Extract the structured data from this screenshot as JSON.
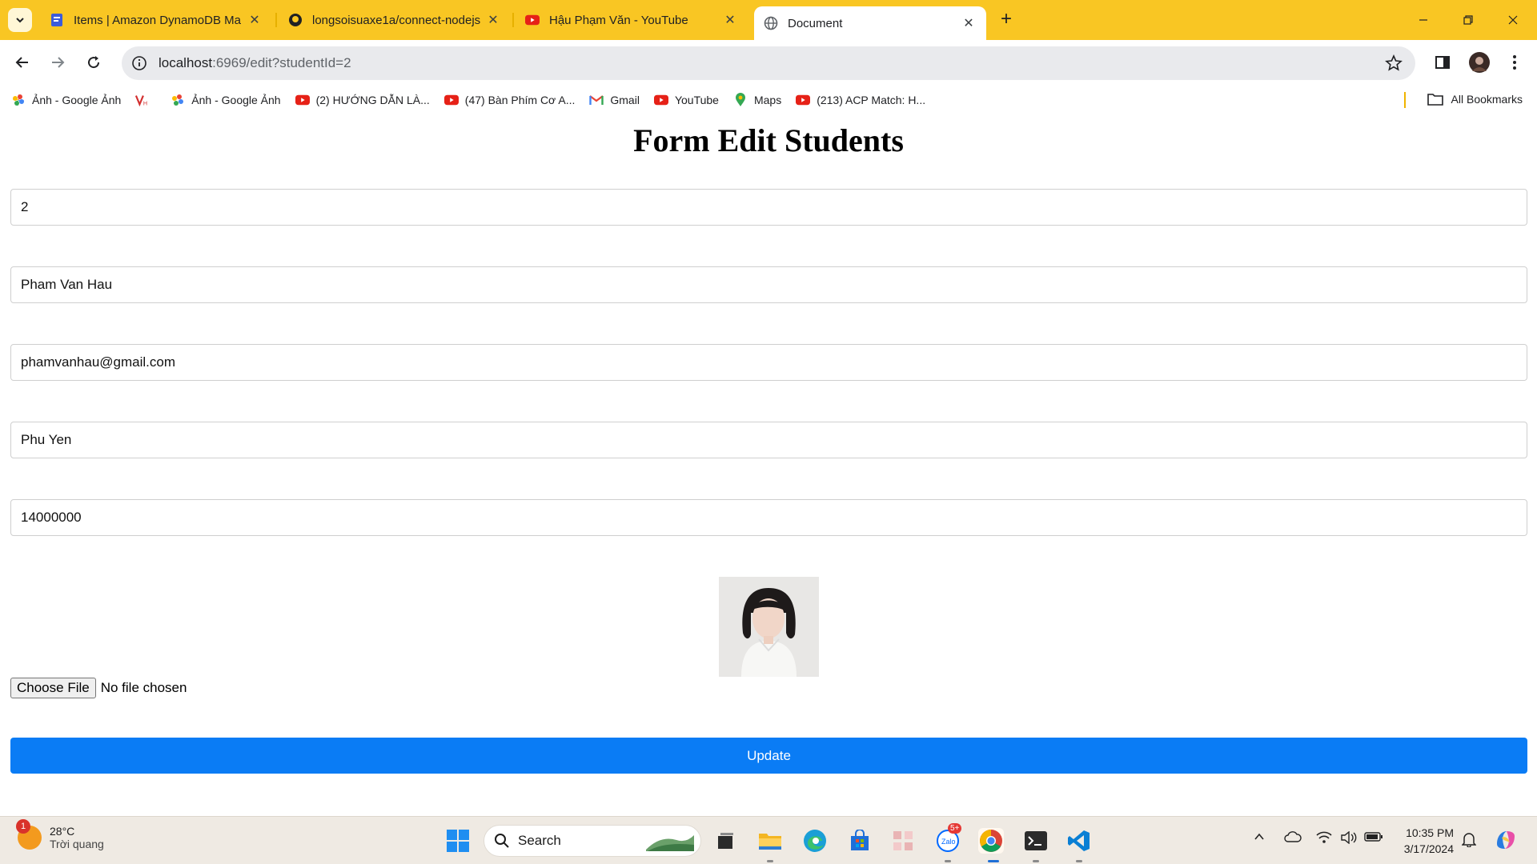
{
  "browser": {
    "tabs": [
      {
        "title": "Items | Amazon DynamoDB Ma",
        "favicon": "dynamodb-icon"
      },
      {
        "title": "longsoisuaxe1a/connect-nodejs",
        "favicon": "github-icon"
      },
      {
        "title": "Hậu Phạm Văn - YouTube",
        "favicon": "youtube-icon"
      },
      {
        "title": "Document",
        "favicon": "globe-icon",
        "active": true
      }
    ],
    "url_host": "localhost",
    "url_rest": ":6969/edit?studentId=2",
    "bookmarks": [
      {
        "label": "Ảnh - Google Ảnh",
        "icon": "google-photos-icon"
      },
      {
        "label": "",
        "icon": "vh-logo-icon"
      },
      {
        "label": "Ảnh - Google Ảnh",
        "icon": "google-photos-icon"
      },
      {
        "label": "(2) HƯỚNG DẪN LÀ...",
        "icon": "youtube-icon"
      },
      {
        "label": "(47) Bàn Phím Cơ A...",
        "icon": "youtube-icon"
      },
      {
        "label": "Gmail",
        "icon": "gmail-icon"
      },
      {
        "label": "YouTube",
        "icon": "youtube-icon"
      },
      {
        "label": "Maps",
        "icon": "maps-icon"
      },
      {
        "label": "(213) ACP Match: H...",
        "icon": "youtube-icon"
      }
    ],
    "all_bookmarks": "All Bookmarks"
  },
  "form": {
    "title": "Form Edit Students",
    "fields": {
      "id": "2",
      "name": "Pham Van Hau",
      "email": "phamvanhau@gmail.com",
      "address": "Phu Yen",
      "amount": "14000000"
    },
    "file_button": "Choose File",
    "file_status": "No file chosen",
    "submit": "Update"
  },
  "taskbar": {
    "weather_temp": "28°C",
    "weather_desc": "Trời quang",
    "weather_badge": "1",
    "search_label": "Search",
    "zalo_badge": "5+",
    "time": "10:35 PM",
    "date": "3/17/2024"
  },
  "colors": {
    "tabstrip": "#f9c623",
    "primary_button": "#0a7cf5"
  }
}
